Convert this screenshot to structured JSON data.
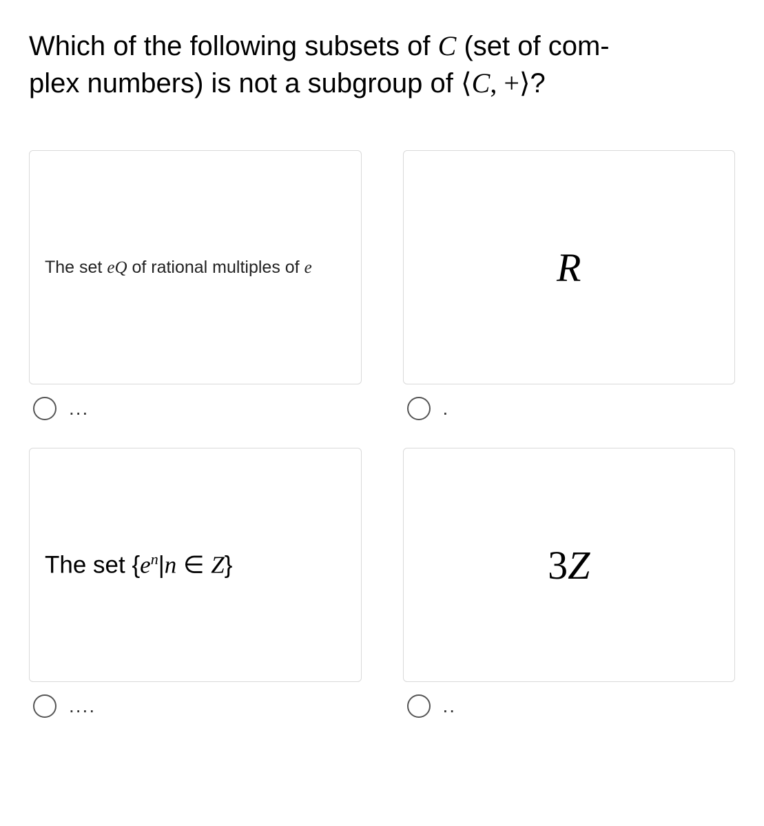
{
  "question": {
    "line1_pre": "Which of the following subsets of ",
    "line1_C": "C",
    "line1_post": " (set of com-",
    "line2_pre": "plex numbers) is not a subgroup of ",
    "line2_group_open": "⟨",
    "line2_C": "C",
    "line2_comma_plus": ", +",
    "line2_group_close": "⟩",
    "line2_qmark": "?"
  },
  "options": [
    {
      "card_prefix": "The set ",
      "card_eQ_e": "e",
      "card_eQ_Q": "Q",
      "card_suffix": " of rational multiples of ",
      "card_trail_e": "e",
      "radio_label": "..."
    },
    {
      "card_big": "R",
      "radio_label": "."
    },
    {
      "card_prefix": "The set ",
      "brace_open": "{",
      "e": "e",
      "sup_n": "n",
      "bar": "|",
      "n": "n",
      "in": " ∈ ",
      "Z": "Z",
      "brace_close": "}",
      "radio_label": "...."
    },
    {
      "card_num": "3",
      "card_Z": "Z",
      "radio_label": ".."
    }
  ]
}
